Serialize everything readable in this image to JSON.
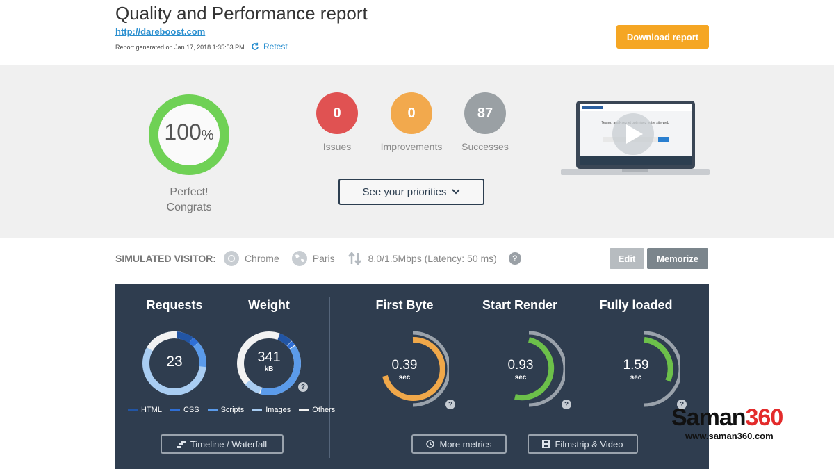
{
  "header": {
    "title": "Quality and Performance report",
    "url": "http://dareboost.com",
    "generated": "Report generated on Jan 17, 2018 1:35:53 PM",
    "retest": "Retest",
    "download": "Download report"
  },
  "summary": {
    "score": "100",
    "score_unit": "%",
    "score_value": 100,
    "score_line1": "Perfect!",
    "score_line2": "Congrats",
    "issues": {
      "count": "0",
      "label": "Issues",
      "color": "#e05252"
    },
    "improvements": {
      "count": "0",
      "label": "Improvements",
      "color": "#f2a94d"
    },
    "successes": {
      "count": "87",
      "label": "Successes",
      "color": "#9aa0a4"
    },
    "priorities_button": "See your priorities",
    "video_thumb_text": "Testez, analysez et optimisez votre site web"
  },
  "visitor": {
    "label": "SIMULATED VISITOR:",
    "browser": "Chrome",
    "location": "Paris",
    "connection": "8.0/1.5Mbps (Latency: 50 ms)",
    "help": "?",
    "edit": "Edit",
    "memorize": "Memorize"
  },
  "metrics": {
    "requests": {
      "title": "Requests",
      "value": "23"
    },
    "weight": {
      "title": "Weight",
      "value": "341",
      "unit": "kB"
    },
    "legend": [
      {
        "label": "HTML",
        "color": "#2255a4"
      },
      {
        "label": "CSS",
        "color": "#2f6fd6"
      },
      {
        "label": "Scripts",
        "color": "#5b9bea"
      },
      {
        "label": "Images",
        "color": "#a9cdf2"
      },
      {
        "label": "Others",
        "color": "#f2f2f2"
      }
    ],
    "first_byte": {
      "title": "First Byte",
      "value": "0.39",
      "unit": "sec",
      "color": "#f0a84a"
    },
    "start_render": {
      "title": "Start Render",
      "value": "0.93",
      "unit": "sec",
      "color": "#6cc04a"
    },
    "fully_loaded": {
      "title": "Fully loaded",
      "value": "1.59",
      "unit": "sec",
      "color": "#6cc04a"
    },
    "timeline_button": "Timeline / Waterfall",
    "more_metrics_button": "More metrics",
    "filmstrip_button": "Filmstrip & Video",
    "help": "?"
  },
  "watermark": {
    "brand_text": "Saman",
    "brand_num": "360",
    "url": "www.saman360.com"
  }
}
